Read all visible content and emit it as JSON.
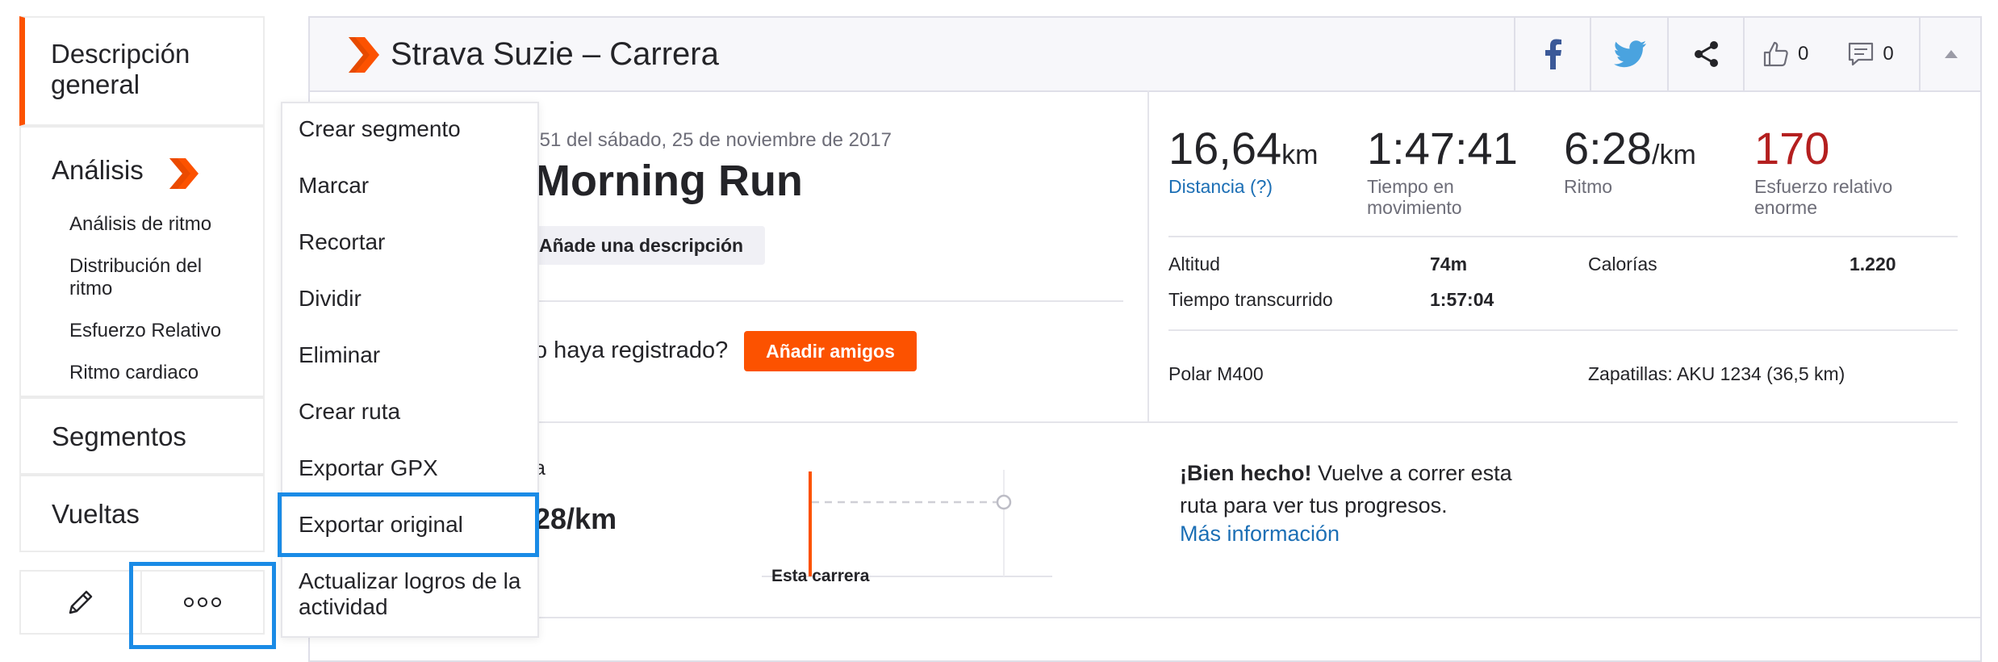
{
  "sidebar": {
    "overview": "Descripción general",
    "analysis": "Análisis",
    "analysis_items": [
      "Análisis de ritmo",
      "Distribución del ritmo",
      "Esfuerzo Relativo",
      "Ritmo cardiaco"
    ],
    "segments": "Segmentos",
    "laps": "Vueltas"
  },
  "header": {
    "title": "Strava Suzie – Carrera",
    "kudos_count": "0",
    "comments_count": "0"
  },
  "activity": {
    "datetime": ":51 del sábado, 25 de noviembre de 2017",
    "name": "Morning Run",
    "add_description": "Añade una descripción",
    "friends_prompt": "o haya registrado?",
    "add_friends": "Añadir amigos"
  },
  "stats": {
    "distance": {
      "value": "16,64",
      "unit": "km",
      "label": "Distancia (?)"
    },
    "moving_time": {
      "value": "1:47:41",
      "label": "Tiempo en movimiento"
    },
    "pace": {
      "value": "6:28",
      "unit": "/km",
      "label": "Ritmo"
    },
    "relative_effort": {
      "value": "170",
      "label": "Esfuerzo relativo enorme"
    },
    "elevation_label": "Altitud",
    "elevation_value": "74m",
    "calories_label": "Calorías",
    "calories_value": "1.220",
    "elapsed_label": "Tiempo transcurrido",
    "elapsed_value": "1:57:04",
    "device": "Polar M400",
    "shoes": "Zapatillas: AKU 1234 (36,5 km)"
  },
  "comparison": {
    "partial_label": "a",
    "pace_value": "28/km",
    "chart_label": "Esta carrera",
    "well_done": "¡Bien hecho!",
    "message": " Vuelve a correr esta ruta para ver tus progresos.",
    "more_info": "Más información"
  },
  "menu": {
    "items": [
      "Crear segmento",
      "Marcar",
      "Recortar",
      "Dividir",
      "Eliminar",
      "Crear ruta",
      "Exportar GPX",
      "Exportar original",
      "Actualizar logros de la actividad"
    ]
  },
  "colors": {
    "accent": "#fc5200",
    "highlight": "#1a8be6",
    "link": "#1c6fb5",
    "effort": "#b41f1f"
  }
}
